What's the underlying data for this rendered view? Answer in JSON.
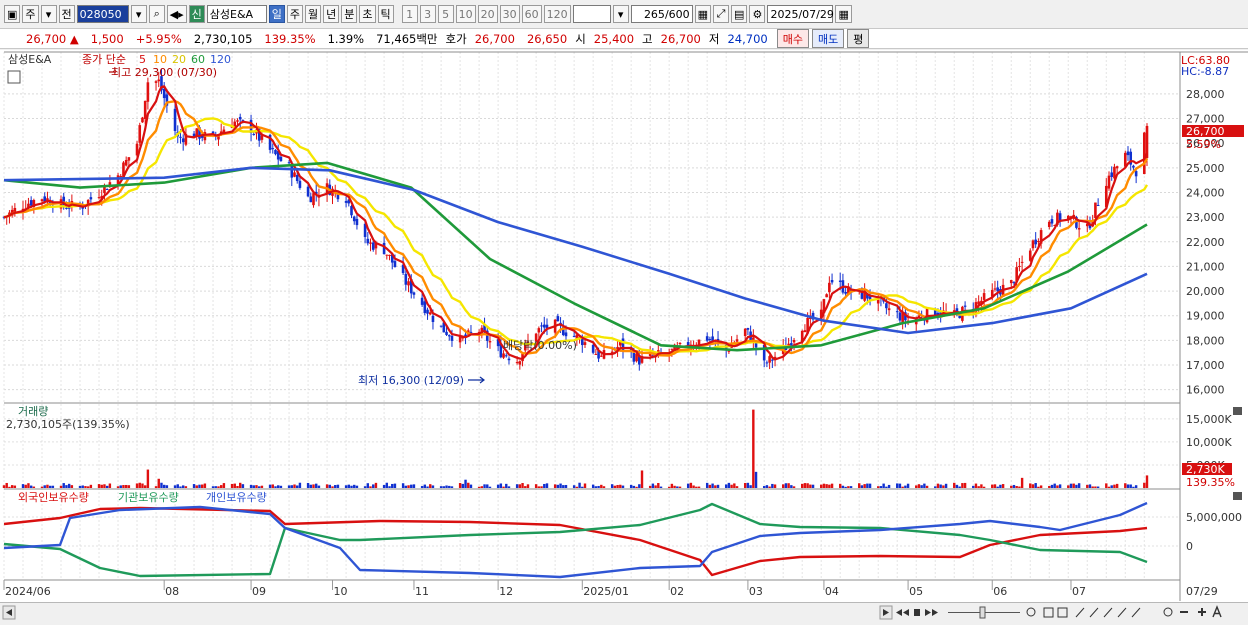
{
  "toolbar": {
    "market_toggle": "주",
    "prev_label": "전",
    "stock_code": "028050",
    "credit_badge": "신",
    "stock_name": "삼성E&A",
    "periods": [
      "일",
      "주",
      "월",
      "년",
      "분",
      "초",
      "틱"
    ],
    "active_period": "일",
    "intervals": [
      "1",
      "3",
      "5",
      "10",
      "20",
      "30",
      "60",
      "120"
    ],
    "count_value": "265",
    "count_total": "/600",
    "date_value": "2025/07/29"
  },
  "quote": {
    "price": "26,700",
    "change": "1,500",
    "change_pct": "+5.95%",
    "volume": "2,730,105",
    "volume_ratio": "139.35%",
    "turnover": "1.39%",
    "amount": "71,465백만",
    "ask_label": "호가",
    "ask": "26,700",
    "bid": "26,650",
    "open_label": "시",
    "open": "25,400",
    "high_label": "고",
    "high": "26,700",
    "low_label": "저",
    "low": "24,700",
    "buy_label": "매수",
    "sell_label": "매도",
    "eval_label": "평"
  },
  "chart_data": [
    {
      "type": "candlestick",
      "title": "삼성E&A",
      "legend_prefix": "종가 단순",
      "ma_periods": [
        "5",
        "10",
        "20",
        "60",
        "120"
      ],
      "ma_colors": [
        "#d81010",
        "#ff8c00",
        "#f5e600",
        "#1f9a3a",
        "#2f55d4"
      ],
      "x_tick_labels": [
        "2024/06",
        "08",
        "09",
        "10",
        "11",
        "12",
        "2025/01",
        "02",
        "03",
        "04",
        "05",
        "06",
        "07",
        "07/29"
      ],
      "y_tick_labels": [
        "16,000",
        "17,000",
        "18,000",
        "19,000",
        "20,000",
        "21,000",
        "22,000",
        "23,000",
        "24,000",
        "25,000",
        "26,000",
        "27,000",
        "28,000"
      ],
      "ylim": [
        15500,
        29700
      ],
      "close_path": [
        [
          "2024/06/03",
          23000
        ],
        [
          "2024/06/10",
          23500
        ],
        [
          "2024/06/17",
          23800
        ],
        [
          "2024/06/24",
          23500
        ],
        [
          "2024/07/01",
          23400
        ],
        [
          "2024/07/08",
          24000
        ],
        [
          "2024/07/15",
          24700
        ],
        [
          "2024/07/22",
          26000
        ],
        [
          "2024/07/26",
          28500
        ],
        [
          "2024/07/30",
          28500
        ],
        [
          "2024/08/02",
          27500
        ],
        [
          "2024/08/06",
          26200
        ],
        [
          "2024/08/12",
          26400
        ],
        [
          "2024/08/19",
          26200
        ],
        [
          "2024/08/26",
          26900
        ],
        [
          "2024/09/02",
          26600
        ],
        [
          "2024/09/09",
          25700
        ],
        [
          "2024/09/16",
          25000
        ],
        [
          "2024/09/23",
          23800
        ],
        [
          "2024/09/30",
          24200
        ],
        [
          "2024/10/07",
          23800
        ],
        [
          "2024/10/14",
          22000
        ],
        [
          "2024/10/21",
          21700
        ],
        [
          "2024/10/28",
          20500
        ],
        [
          "2024/11/04",
          19500
        ],
        [
          "2024/11/11",
          18500
        ],
        [
          "2024/11/18",
          18000
        ],
        [
          "2024/11/25",
          18400
        ],
        [
          "2024/12/02",
          17600
        ],
        [
          "2024/12/09",
          17200
        ],
        [
          "2024/12/16",
          18400
        ],
        [
          "2024/12/23",
          18600
        ],
        [
          "2025/01/02",
          18000
        ],
        [
          "2025/01/09",
          17300
        ],
        [
          "2025/01/16",
          17800
        ],
        [
          "2025/01/23",
          17200
        ],
        [
          "2025/02/03",
          17500
        ],
        [
          "2025/02/10",
          17800
        ],
        [
          "2025/02/17",
          18100
        ],
        [
          "2025/02/24",
          17600
        ],
        [
          "2025/03/03",
          18400
        ],
        [
          "2025/03/06",
          18000
        ],
        [
          "2025/03/10",
          17000
        ],
        [
          "2025/03/17",
          17600
        ],
        [
          "2025/03/24",
          18600
        ],
        [
          "2025/03/31",
          19000
        ],
        [
          "2025/04/03",
          20500
        ],
        [
          "2025/04/10",
          20000
        ],
        [
          "2025/04/17",
          19800
        ],
        [
          "2025/04/24",
          19300
        ],
        [
          "2025/05/02",
          18800
        ],
        [
          "2025/05/12",
          19200
        ],
        [
          "2025/05/19",
          19000
        ],
        [
          "2025/05/26",
          19400
        ],
        [
          "2025/06/02",
          19900
        ],
        [
          "2025/06/09",
          20300
        ],
        [
          "2025/06/16",
          21800
        ],
        [
          "2025/06/23",
          22900
        ],
        [
          "2025/06/30",
          23000
        ],
        [
          "2025/07/07",
          22500
        ],
        [
          "2025/07/14",
          24500
        ],
        [
          "2025/07/21",
          25500
        ],
        [
          "2025/07/25",
          24900
        ],
        [
          "2025/07/29",
          26700
        ]
      ],
      "ma120_path": [
        [
          "2024/06/03",
          24500
        ],
        [
          "2024/08/01",
          24600
        ],
        [
          "2024/09/02",
          25000
        ],
        [
          "2024/10/01",
          24900
        ],
        [
          "2024/11/01",
          24100
        ],
        [
          "2024/12/02",
          22800
        ],
        [
          "2025/01/02",
          21800
        ],
        [
          "2025/02/03",
          20700
        ],
        [
          "2025/03/03",
          19700
        ],
        [
          "2025/04/01",
          18800
        ],
        [
          "2025/05/02",
          18300
        ],
        [
          "2025/06/02",
          18700
        ],
        [
          "2025/07/01",
          19300
        ],
        [
          "2025/07/29",
          20700
        ]
      ],
      "ma60_path": [
        [
          "2024/06/03",
          24500
        ],
        [
          "2024/07/01",
          24200
        ],
        [
          "2024/08/01",
          24400
        ],
        [
          "2024/09/02",
          25000
        ],
        [
          "2024/09/30",
          25200
        ],
        [
          "2024/10/31",
          24200
        ],
        [
          "2024/11/29",
          21300
        ],
        [
          "2024/12/30",
          19500
        ],
        [
          "2025/01/31",
          17800
        ],
        [
          "2025/02/28",
          17600
        ],
        [
          "2025/03/31",
          17800
        ],
        [
          "2025/04/30",
          18700
        ],
        [
          "2025/05/30",
          19300
        ],
        [
          "2025/06/30",
          20800
        ],
        [
          "2025/07/29",
          22700
        ]
      ],
      "annotations": {
        "max_label": "최고 29,300 (07/30)",
        "min_label": "최저 16,300 (12/09)",
        "dividend_label": "배당락(0.00%)",
        "lc_label": "LC:63.80",
        "hc_label": "HC:-8.87",
        "last_price_tag": "26,700",
        "last_change_tag": "5.59%"
      }
    },
    {
      "type": "bar",
      "title": "거래량",
      "summary": "2,730,105주(139.35%)",
      "y_tick_labels": [
        "5,000K",
        "10,000K",
        "15,000K"
      ],
      "ylim": [
        0,
        18000000
      ],
      "spike_values": [
        [
          "2024/07/26",
          4000000
        ],
        [
          "2024/07/30",
          2000000
        ],
        [
          "2024/11/20",
          1800000
        ],
        [
          "2025/01/24",
          3800000
        ],
        [
          "2025/03/06",
          17000000
        ],
        [
          "2025/03/07",
          3500000
        ],
        [
          "2025/06/13",
          2200000
        ],
        [
          "2025/07/29",
          2730105
        ]
      ],
      "last_value_tag": "2,730K",
      "last_ratio_tag": "139.35%"
    },
    {
      "type": "line",
      "series_names": [
        "외국인보유수량",
        "기관보유수량",
        "개인보유수량"
      ],
      "series_colors": [
        "#d81010",
        "#1f9a5a",
        "#2f55d4"
      ],
      "y_tick_labels": [
        "0",
        "5,000,000"
      ]
    }
  ]
}
